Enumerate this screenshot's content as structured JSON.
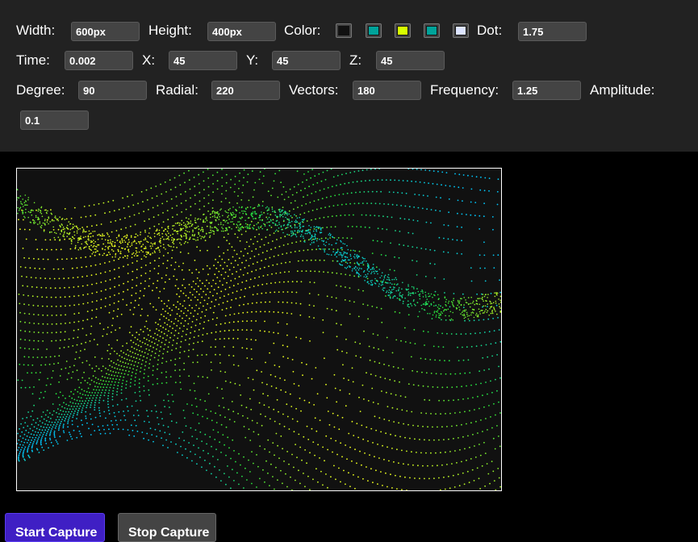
{
  "controls": {
    "width": {
      "label": "Width:",
      "value": "600px"
    },
    "height": {
      "label": "Height:",
      "value": "400px"
    },
    "color": {
      "label": "Color:",
      "swatches": [
        "#111111",
        "#00a39a",
        "#d8ff00",
        "#00a39a",
        "#dde4ff"
      ]
    },
    "dot": {
      "label": "Dot:",
      "value": "1.75"
    },
    "time": {
      "label": "Time:",
      "value": "0.002"
    },
    "x": {
      "label": "X:",
      "value": "45"
    },
    "y": {
      "label": "Y:",
      "value": "45"
    },
    "z": {
      "label": "Z:",
      "value": "45"
    },
    "degree": {
      "label": "Degree:",
      "value": "90"
    },
    "radial": {
      "label": "Radial:",
      "value": "220"
    },
    "vectors": {
      "label": "Vectors:",
      "value": "180"
    },
    "frequency": {
      "label": "Frequency:",
      "value": "1.25"
    },
    "amplitude": {
      "label": "Amplitude:",
      "value": "0.1"
    }
  },
  "buttons": {
    "start_capture": "Start Capture",
    "stop_capture": "Stop Capture"
  },
  "colors": {
    "panel_bg": "#222222",
    "canvas_bg": "#111111",
    "start_button": "#3f1fc4",
    "stop_button": "#444444"
  }
}
